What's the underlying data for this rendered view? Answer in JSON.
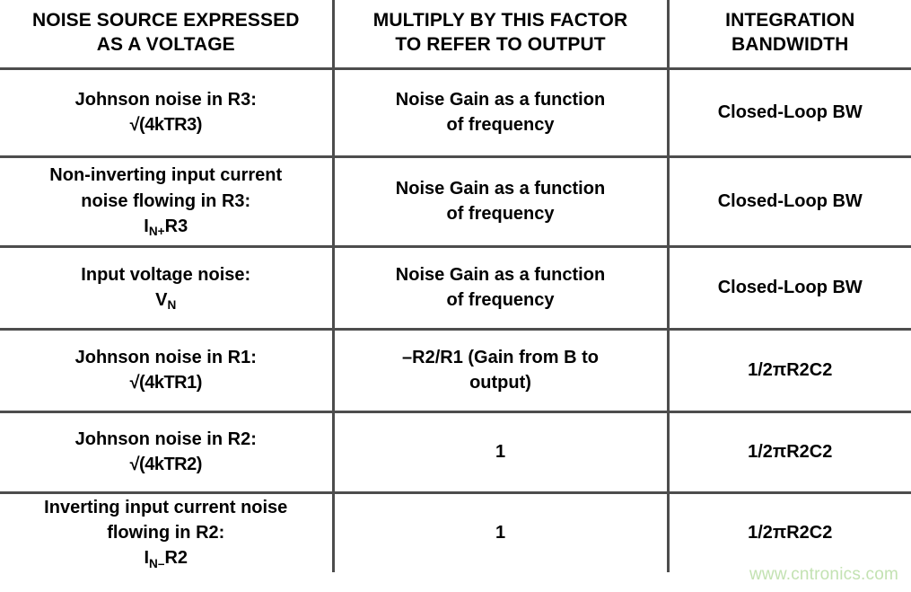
{
  "table": {
    "headers": [
      {
        "line1": "NOISE SOURCE EXPRESSED",
        "line2": "AS A VOLTAGE"
      },
      {
        "line1": "MULTIPLY BY THIS FACTOR",
        "line2": "TO REFER TO OUTPUT"
      },
      {
        "line1": "INTEGRATION",
        "line2": "BANDWIDTH"
      }
    ],
    "rows": [
      {
        "source_line1": "Johnson noise in R3:",
        "source_line2": "√(4kTR3)",
        "source_line3": "",
        "factor_line1": "Noise Gain as a function",
        "factor_line2": "of frequency",
        "bandwidth": "Closed-Loop BW"
      },
      {
        "source_line1": "Non-inverting input current",
        "source_line2": "noise flowing in R3:",
        "source_line3_pre": "I",
        "source_line3_sub": "N+",
        "source_line3_post": "R3",
        "factor_line1": "Noise Gain as a function",
        "factor_line2": "of frequency",
        "bandwidth": "Closed-Loop BW"
      },
      {
        "source_line1": "Input voltage noise:",
        "source_line2_pre": "V",
        "source_line2_sub": "N",
        "source_line2_post": "",
        "factor_line1": "Noise Gain as a function",
        "factor_line2": "of frequency",
        "bandwidth": "Closed-Loop BW"
      },
      {
        "source_line1": "Johnson noise in R1:",
        "source_line2": "√(4kTR1)",
        "factor_line1": "–R2/R1 (Gain from B to",
        "factor_line2": "output)",
        "bandwidth": "1/2πR2C2"
      },
      {
        "source_line1": "Johnson noise in R2:",
        "source_line2": "√(4kTR2)",
        "factor_line1": "1",
        "factor_line2": "",
        "bandwidth": "1/2πR2C2"
      },
      {
        "source_line1": "Inverting input current noise",
        "source_line2": "flowing in R2:",
        "source_line3_pre": "I",
        "source_line3_sub": "N–",
        "source_line3_post": "R2",
        "factor_line1": "1",
        "factor_line2": "",
        "bandwidth": "1/2πR2C2"
      }
    ]
  },
  "watermark": {
    "text": "www.cntronics.com",
    "color": "#c3e2b2"
  },
  "colors": {
    "rule": "#4d4d4d",
    "text": "#000000",
    "background": "#ffffff"
  }
}
